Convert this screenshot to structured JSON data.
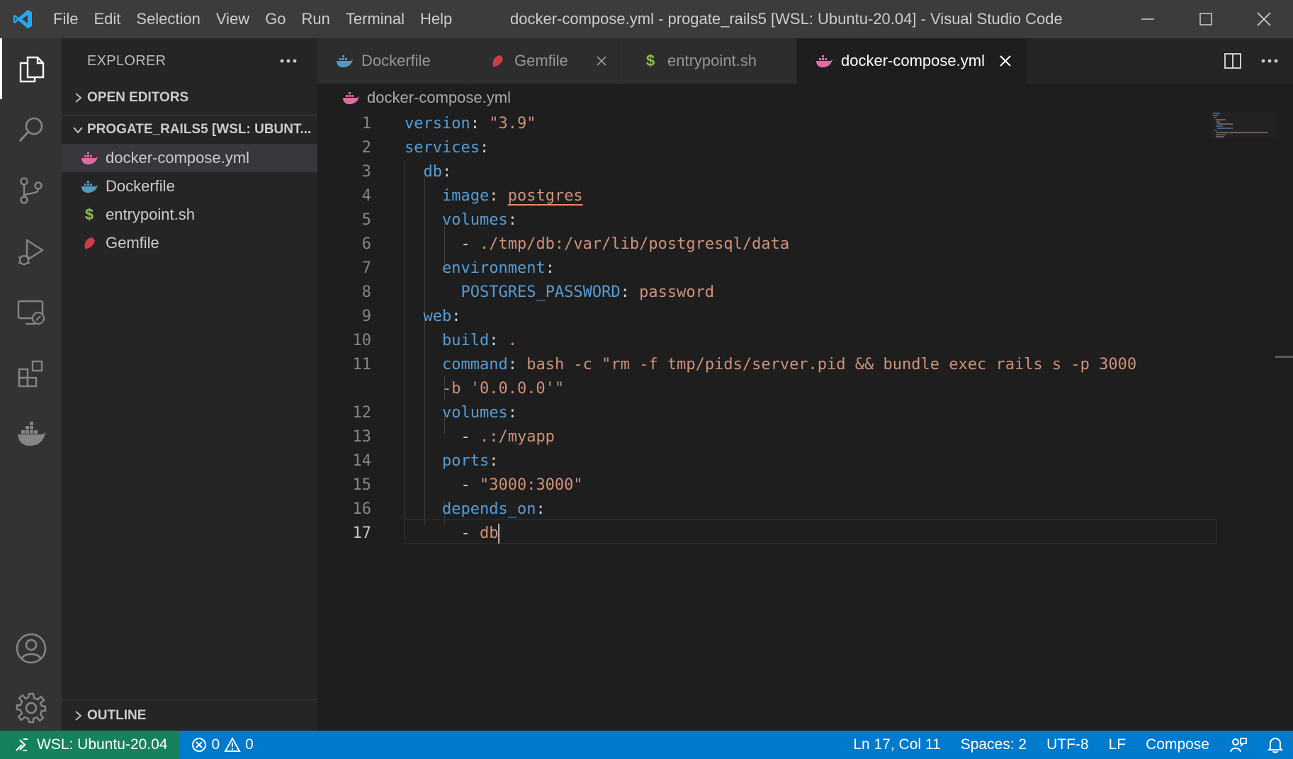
{
  "titlebar": {
    "menu": [
      "File",
      "Edit",
      "Selection",
      "View",
      "Go",
      "Run",
      "Terminal",
      "Help"
    ],
    "window_title": "docker-compose.yml - progate_rails5 [WSL: Ubuntu-20.04] - Visual Studio Code"
  },
  "activity_bar": {
    "items": [
      "explorer-icon",
      "search-icon",
      "source-control-icon",
      "run-debug-icon",
      "remote-explorer-icon",
      "extensions-icon",
      "docker-icon"
    ],
    "bottom_items": [
      "account-icon",
      "settings-gear-icon"
    ]
  },
  "sidebar": {
    "title": "EXPLORER",
    "open_editors": "OPEN EDITORS",
    "folder": "PROGATE_RAILS5 [WSL: UBUNT...",
    "files": [
      {
        "name": "docker-compose.yml",
        "icon": "docker-compose-icon",
        "selected": true
      },
      {
        "name": "Dockerfile",
        "icon": "docker-icon"
      },
      {
        "name": "entrypoint.sh",
        "icon": "shell-icon"
      },
      {
        "name": "Gemfile",
        "icon": "ruby-icon"
      }
    ],
    "outline": "OUTLINE"
  },
  "tabs": [
    {
      "label": "Dockerfile",
      "icon": "docker-icon"
    },
    {
      "label": "Gemfile",
      "icon": "ruby-icon"
    },
    {
      "label": "entrypoint.sh",
      "icon": "shell-icon"
    },
    {
      "label": "docker-compose.yml",
      "icon": "docker-compose-icon",
      "active": true
    }
  ],
  "breadcrumb": "docker-compose.yml",
  "editor": {
    "line_numbers": [
      "1",
      "2",
      "3",
      "4",
      "5",
      "6",
      "7",
      "8",
      "9",
      "10",
      "11",
      "12",
      "13",
      "14",
      "15",
      "16",
      "17"
    ],
    "current_line": "17"
  },
  "statusbar": {
    "remote": "WSL: Ubuntu-20.04",
    "errors": "0",
    "warnings": "0",
    "position": "Ln 17, Col 11",
    "spaces": "Spaces: 2",
    "encoding": "UTF-8",
    "eol": "LF",
    "language": "Compose"
  },
  "colors": {
    "accent": "#007acc",
    "remote": "#16825d",
    "keyword": "#569cd6",
    "string": "#ce9178"
  }
}
